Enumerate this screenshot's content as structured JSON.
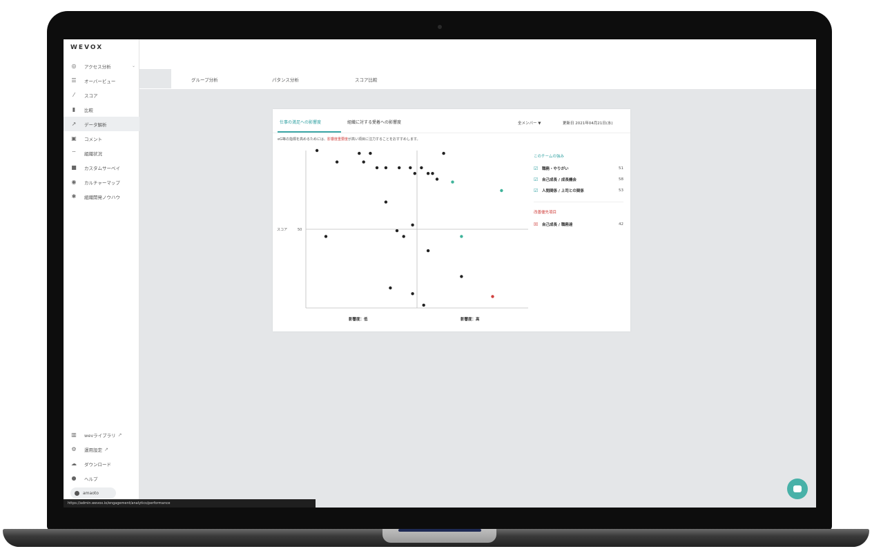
{
  "app": {
    "logo": "WEVOX"
  },
  "sidebar": {
    "items": [
      {
        "label": "アクセス分析",
        "icon": "target-icon"
      },
      {
        "label": "オーバービュー",
        "icon": "list-icon"
      },
      {
        "label": "スコア",
        "icon": "trend-icon"
      },
      {
        "label": "比較",
        "icon": "compare-icon"
      },
      {
        "label": "データ解析",
        "icon": "chart-icon"
      },
      {
        "label": "コメント",
        "icon": "comment-icon"
      },
      {
        "label": "組織状況",
        "icon": "wifi-icon"
      },
      {
        "label": "カスタムサーベイ",
        "icon": "folder-icon"
      },
      {
        "label": "カルチャーマップ",
        "icon": "map-icon"
      },
      {
        "label": "組織開発ノウハウ",
        "icon": "bulb-icon"
      }
    ],
    "bottom": [
      {
        "label": "wevライブラリ",
        "icon": "library-icon"
      },
      {
        "label": "運用設定",
        "icon": "gear-icon"
      },
      {
        "label": "ダウンロード",
        "icon": "download-icon"
      },
      {
        "label": "ヘルプ",
        "icon": "help-icon"
      }
    ],
    "user": "amaoto"
  },
  "tabs": [
    "グループ分析",
    "パタンス分析",
    "スコア比較"
  ],
  "card": {
    "tabs": [
      "仕事の満足への影響度",
      "組織に対する愛着への影響度"
    ],
    "note_prefix": "eG等の指標を高めるためには、",
    "note_highlight": "影響度重要度",
    "note_suffix": "が高い項目に注力することをおすすめします。",
    "member_filter": "全メンバー ▼",
    "updated": "更新日 2021年04月21日(水)",
    "panel": {
      "good_title": "このチームの強み",
      "good_items": [
        {
          "label": "職務・やりがい",
          "value": "51"
        },
        {
          "label": "自己成長 / 成長機会",
          "value": "58"
        },
        {
          "label": "人間関係 / 上司との関係",
          "value": "53"
        }
      ],
      "bad_title": "改善優先項目",
      "bad_items": [
        {
          "label": "自己成長 / 職務達",
          "value": "42"
        }
      ]
    }
  },
  "chart_data": {
    "type": "scatter",
    "ylabel": "スコア",
    "xlabels": [
      "影響度：低",
      "影響度：高"
    ],
    "ytick_mid": "50",
    "colors": {
      "neutral": "#222222",
      "strength": "#3fb39a",
      "priority": "#d0413e"
    },
    "points": [
      {
        "x": 0.05,
        "y": 80,
        "c": "neutral"
      },
      {
        "x": 0.09,
        "y": 50,
        "c": "neutral"
      },
      {
        "x": 0.14,
        "y": 76,
        "c": "neutral"
      },
      {
        "x": 0.24,
        "y": 79,
        "c": "neutral"
      },
      {
        "x": 0.26,
        "y": 76,
        "c": "neutral"
      },
      {
        "x": 0.29,
        "y": 79,
        "c": "neutral"
      },
      {
        "x": 0.32,
        "y": 74,
        "c": "neutral"
      },
      {
        "x": 0.36,
        "y": 74,
        "c": "neutral"
      },
      {
        "x": 0.36,
        "y": 62,
        "c": "neutral"
      },
      {
        "x": 0.42,
        "y": 74,
        "c": "neutral"
      },
      {
        "x": 0.47,
        "y": 74,
        "c": "neutral"
      },
      {
        "x": 0.49,
        "y": 72,
        "c": "neutral"
      },
      {
        "x": 0.52,
        "y": 74,
        "c": "neutral"
      },
      {
        "x": 0.55,
        "y": 72,
        "c": "neutral"
      },
      {
        "x": 0.57,
        "y": 72,
        "c": "neutral"
      },
      {
        "x": 0.59,
        "y": 70,
        "c": "neutral"
      },
      {
        "x": 0.62,
        "y": 79,
        "c": "neutral"
      },
      {
        "x": 0.41,
        "y": 52,
        "c": "neutral"
      },
      {
        "x": 0.44,
        "y": 50,
        "c": "neutral"
      },
      {
        "x": 0.48,
        "y": 54,
        "c": "neutral"
      },
      {
        "x": 0.55,
        "y": 45,
        "c": "neutral"
      },
      {
        "x": 0.38,
        "y": 32,
        "c": "neutral"
      },
      {
        "x": 0.48,
        "y": 30,
        "c": "neutral"
      },
      {
        "x": 0.53,
        "y": 26,
        "c": "neutral"
      },
      {
        "x": 0.7,
        "y": 36,
        "c": "neutral"
      },
      {
        "x": 0.66,
        "y": 69,
        "c": "strength"
      },
      {
        "x": 0.88,
        "y": 66,
        "c": "strength"
      },
      {
        "x": 0.7,
        "y": 50,
        "c": "strength"
      },
      {
        "x": 0.84,
        "y": 29,
        "c": "priority"
      }
    ]
  },
  "footer": {
    "url": "https://admin.wevox.io/engagement/analytics/performance"
  }
}
